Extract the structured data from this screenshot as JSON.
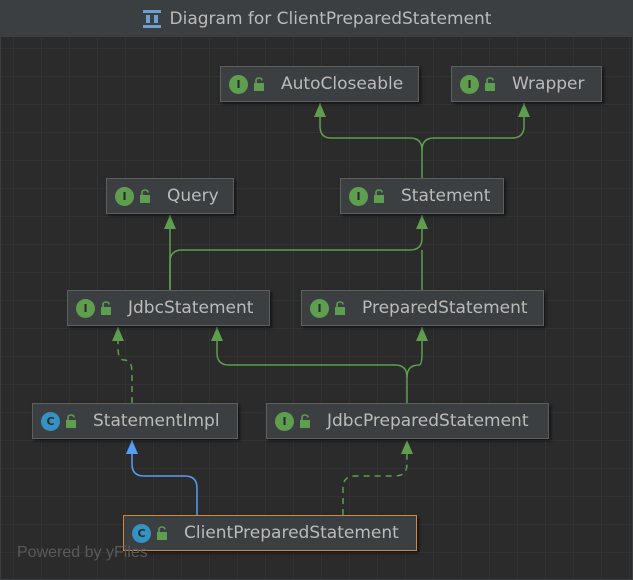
{
  "window": {
    "title": "Diagram for ClientPreparedStatement",
    "title_icon": "diagram-icon"
  },
  "colors": {
    "background": "#2b2b2b",
    "node_fill": "#3c3f41",
    "node_border": "#5e6060",
    "interface_badge": "#5e9e4e",
    "class_badge": "#3592c4",
    "interface_edge": "#5e9e4e",
    "extends_edge": "#589df6",
    "selected_border": "#d0873e"
  },
  "nodes": {
    "autocloseable": {
      "label": "AutoCloseable",
      "kind": "I",
      "icon": "interface-icon"
    },
    "wrapper": {
      "label": "Wrapper",
      "kind": "I",
      "icon": "interface-icon"
    },
    "query": {
      "label": "Query",
      "kind": "I",
      "icon": "interface-icon"
    },
    "statement": {
      "label": "Statement",
      "kind": "I",
      "icon": "interface-icon"
    },
    "jdbc_statement": {
      "label": "JdbcStatement",
      "kind": "I",
      "icon": "interface-icon"
    },
    "prepared_statement": {
      "label": "PreparedStatement",
      "kind": "I",
      "icon": "interface-icon"
    },
    "statement_impl": {
      "label": "StatementImpl",
      "kind": "C",
      "icon": "class-icon"
    },
    "jdbc_prepared_statement": {
      "label": "JdbcPreparedStatement",
      "kind": "I",
      "icon": "interface-icon"
    },
    "client_prepared_statement": {
      "label": "ClientPreparedStatement",
      "kind": "C",
      "icon": "class-icon",
      "selected": true
    }
  },
  "edges": [
    {
      "from": "Statement",
      "to": "AutoCloseable",
      "type": "extends-interface"
    },
    {
      "from": "Statement",
      "to": "Wrapper",
      "type": "extends-interface"
    },
    {
      "from": "JdbcStatement",
      "to": "Query",
      "type": "extends-interface"
    },
    {
      "from": "JdbcStatement",
      "to": "Statement",
      "type": "extends-interface"
    },
    {
      "from": "PreparedStatement",
      "to": "Statement",
      "type": "extends-interface"
    },
    {
      "from": "StatementImpl",
      "to": "JdbcStatement",
      "type": "implements"
    },
    {
      "from": "JdbcPreparedStatement",
      "to": "JdbcStatement",
      "type": "extends-interface"
    },
    {
      "from": "JdbcPreparedStatement",
      "to": "PreparedStatement",
      "type": "extends-interface"
    },
    {
      "from": "ClientPreparedStatement",
      "to": "StatementImpl",
      "type": "extends-class"
    },
    {
      "from": "ClientPreparedStatement",
      "to": "JdbcPreparedStatement",
      "type": "implements"
    }
  ],
  "watermark": "Powered by yFiles"
}
